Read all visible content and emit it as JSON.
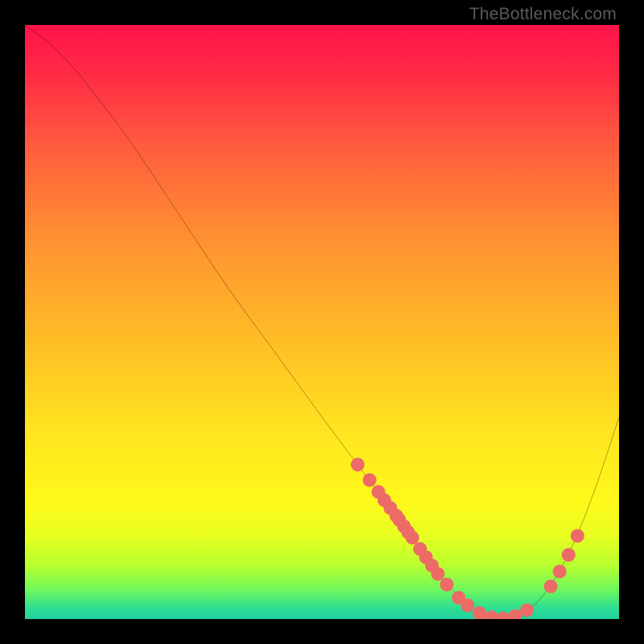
{
  "attribution": "TheBottleneck.com",
  "chart_data": {
    "type": "line",
    "title": "",
    "xlabel": "",
    "ylabel": "",
    "xlim": [
      0,
      100
    ],
    "ylim": [
      0,
      100
    ],
    "curve": {
      "x": [
        0,
        4,
        8,
        12,
        18,
        26,
        34,
        42,
        50,
        56,
        62,
        67,
        71,
        74,
        77,
        80,
        84,
        88,
        92,
        96,
        100
      ],
      "y": [
        100,
        97,
        93,
        88,
        80,
        68,
        56,
        45,
        34,
        26,
        18,
        11,
        6,
        3,
        1,
        0,
        1,
        5,
        12,
        22,
        34
      ]
    },
    "dots": [
      {
        "x": 56,
        "y": 26.0
      },
      {
        "x": 58,
        "y": 23.4
      },
      {
        "x": 59.5,
        "y": 21.4
      },
      {
        "x": 60.5,
        "y": 20.0
      },
      {
        "x": 61.5,
        "y": 18.7
      },
      {
        "x": 62.5,
        "y": 17.4
      },
      {
        "x": 63.0,
        "y": 16.7
      },
      {
        "x": 63.8,
        "y": 15.6
      },
      {
        "x": 64.5,
        "y": 14.6
      },
      {
        "x": 65.2,
        "y": 13.7
      },
      {
        "x": 66.5,
        "y": 11.8
      },
      {
        "x": 67.5,
        "y": 10.4
      },
      {
        "x": 68.5,
        "y": 9.0
      },
      {
        "x": 69.5,
        "y": 7.6
      },
      {
        "x": 71.0,
        "y": 5.8
      },
      {
        "x": 73.0,
        "y": 3.6
      },
      {
        "x": 74.5,
        "y": 2.3
      },
      {
        "x": 76.5,
        "y": 1.0
      },
      {
        "x": 78.5,
        "y": 0.3
      },
      {
        "x": 80.5,
        "y": 0.1
      },
      {
        "x": 82.5,
        "y": 0.5
      },
      {
        "x": 84.5,
        "y": 1.5
      },
      {
        "x": 88.5,
        "y": 5.5
      },
      {
        "x": 90.0,
        "y": 8.0
      },
      {
        "x": 91.5,
        "y": 10.8
      },
      {
        "x": 93.0,
        "y": 14.0
      }
    ],
    "colors": {
      "curve_stroke": "#000000",
      "dot_fill": "#ec6b66"
    }
  }
}
